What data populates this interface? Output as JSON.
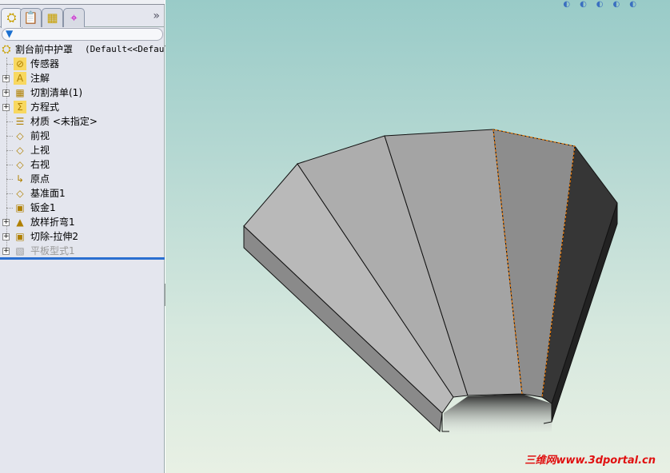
{
  "tabs": [
    {
      "icon": "feature-manager-icon",
      "glyph": "⛭"
    },
    {
      "icon": "property-manager-icon",
      "glyph": "📋"
    },
    {
      "icon": "configuration-manager-icon",
      "glyph": "▦"
    },
    {
      "icon": "dimxpert-icon",
      "glyph": "⌖"
    }
  ],
  "tabs_more": "»",
  "filter_icon": "▼",
  "tree": {
    "root": {
      "label": "割台前中护罩",
      "config": "(Default<<Default"
    },
    "items": [
      {
        "label": "传感器",
        "icon": "sensor-folder-icon",
        "glyph": "⊘",
        "expand": false
      },
      {
        "label": "注解",
        "icon": "annotations-folder-icon",
        "glyph": "A",
        "expand": true
      },
      {
        "label": "切割清单(1)",
        "icon": "cut-list-icon",
        "glyph": "▦",
        "expand": true
      },
      {
        "label": "方程式",
        "icon": "equations-folder-icon",
        "glyph": "Σ",
        "expand": true
      },
      {
        "label": "材质 <未指定>",
        "icon": "material-icon",
        "glyph": "☰",
        "expand": false
      },
      {
        "label": "前视",
        "icon": "plane-icon",
        "glyph": "◇",
        "expand": false
      },
      {
        "label": "上视",
        "icon": "plane-icon",
        "glyph": "◇",
        "expand": false
      },
      {
        "label": "右视",
        "icon": "plane-icon",
        "glyph": "◇",
        "expand": false
      },
      {
        "label": "原点",
        "icon": "origin-icon",
        "glyph": "↳",
        "expand": false
      },
      {
        "label": "基准面1",
        "icon": "plane-icon",
        "glyph": "◇",
        "expand": false
      },
      {
        "label": "钣金1",
        "icon": "sheet-metal-icon",
        "glyph": "▣",
        "expand": false
      },
      {
        "label": "放样折弯1",
        "icon": "lofted-bend-icon",
        "glyph": "▲",
        "expand": true
      },
      {
        "label": "切除-拉伸2",
        "icon": "cut-extrude-icon",
        "glyph": "▣",
        "expand": true
      },
      {
        "label": "平板型式1",
        "icon": "flat-pattern-icon",
        "glyph": "▧",
        "expand": true,
        "suppressed": true
      }
    ]
  },
  "watermark": "三维网www.3dportal.cn",
  "colors": {
    "accent": "#2a6fd0",
    "edge_highlight": "#ff8000",
    "watermark": "#e01010"
  }
}
